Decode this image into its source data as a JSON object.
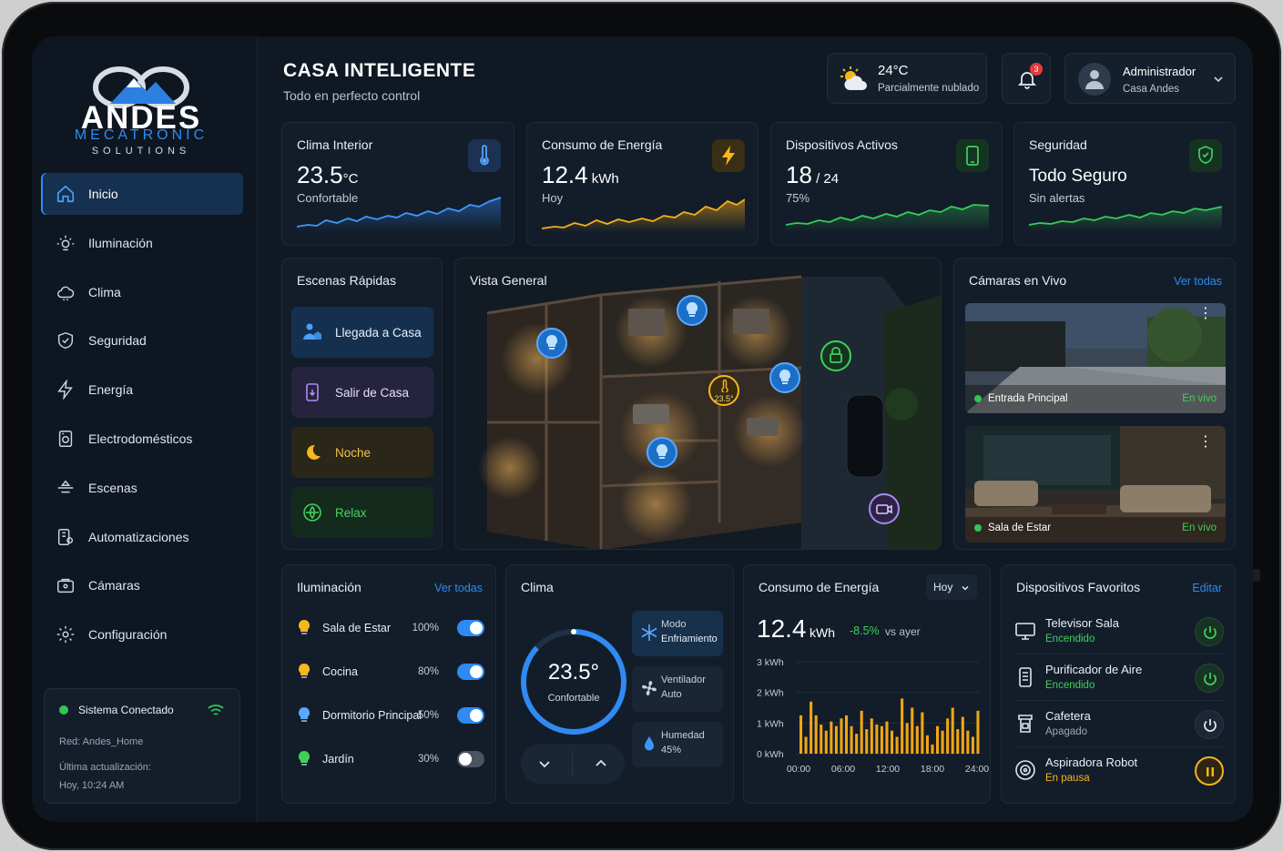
{
  "brand": {
    "name": "ANDES",
    "line2": "MECATRONIC",
    "line3": "SOLUTIONS"
  },
  "nav": {
    "items": [
      {
        "label": "Inicio",
        "icon": "home-icon"
      },
      {
        "label": "Iluminación",
        "icon": "sun-icon"
      },
      {
        "label": "Clima",
        "icon": "cloud-icon"
      },
      {
        "label": "Seguridad",
        "icon": "shield-icon"
      },
      {
        "label": "Energía",
        "icon": "bolt-icon"
      },
      {
        "label": "Electrodomésticos",
        "icon": "appliance-icon"
      },
      {
        "label": "Escenas",
        "icon": "scenes-icon"
      },
      {
        "label": "Automatizaciones",
        "icon": "automation-icon"
      },
      {
        "label": "Cámaras",
        "icon": "camera-icon"
      },
      {
        "label": "Configuración",
        "icon": "gear-icon"
      }
    ]
  },
  "system": {
    "status": "Sistema Conectado",
    "network": "Red: Andes_Home",
    "updated_label": "Última actualización:",
    "updated_value": "Hoy, 10:24 AM"
  },
  "header": {
    "title": "CASA INTELIGENTE",
    "subtitle": "Todo en perfecto control"
  },
  "weather": {
    "temp": "24°C",
    "desc": "Parcialmente nublado"
  },
  "notifications": {
    "count": "3"
  },
  "user": {
    "name": "Administrador",
    "home": "Casa Andes"
  },
  "stats": {
    "climate": {
      "title": "Clima Interior",
      "value": "23.5",
      "unit": "°C",
      "sub": "Confortable"
    },
    "energy": {
      "title": "Consumo de Energía",
      "value": "12.4",
      "unit": " kWh",
      "sub": "Hoy"
    },
    "devices": {
      "title": "Dispositivos Activos",
      "value": "18",
      "unit": " / 24",
      "sub": "75%"
    },
    "security": {
      "title": "Seguridad",
      "value": "Todo Seguro",
      "sub": "Sin alertas"
    }
  },
  "scenes": {
    "title": "Escenas Rápidas",
    "items": [
      "Llegada a Casa",
      "Salir de Casa",
      "Noche",
      "Relax"
    ]
  },
  "overview": {
    "title": "Vista General",
    "temp_marker": "23.5°"
  },
  "cameras": {
    "title": "Cámaras en Vivo",
    "link": "Ver todas",
    "items": [
      {
        "name": "Entrada Principal",
        "status": "En vivo"
      },
      {
        "name": "Sala de Estar",
        "status": "En vivo"
      }
    ]
  },
  "lighting": {
    "title": "Iluminación",
    "link": "Ver todas",
    "items": [
      {
        "name": "Sala de Estar",
        "pct": "100%",
        "on": true,
        "color": "#f5b81d"
      },
      {
        "name": "Cocina",
        "pct": "80%",
        "on": true,
        "color": "#f5b81d"
      },
      {
        "name": "Dormitorio Principal",
        "pct": "50%",
        "on": true,
        "color": "#5aa9ff"
      },
      {
        "name": "Jardín",
        "pct": "30%",
        "on": false,
        "color": "#3fd05a"
      }
    ]
  },
  "climate": {
    "title": "Clima",
    "value": "23.5°",
    "label": "Confortable",
    "modes": [
      {
        "a": "Modo",
        "b": "Enfriamiento"
      },
      {
        "a": "Ventilador",
        "b": "Auto"
      },
      {
        "a": "Humedad",
        "b": "45%"
      }
    ]
  },
  "energy": {
    "title": "Consumo de Energía",
    "period": "Hoy",
    "value": "12.4",
    "unit": "kWh",
    "delta": "-8.5%",
    "delta_suffix": "vs ayer"
  },
  "chart_data": {
    "type": "bar",
    "title": "",
    "ylabel": "",
    "xlabel": "",
    "ylim": [
      0,
      3
    ],
    "yticks": [
      "3 kWh",
      "2 kWh",
      "1 kWh",
      "0 kWh"
    ],
    "xticks": [
      "00:00",
      "06:00",
      "12:00",
      "18:00",
      "24:00"
    ],
    "values": [
      1.25,
      0.55,
      1.7,
      1.25,
      0.95,
      0.75,
      1.05,
      0.9,
      1.15,
      1.25,
      0.9,
      0.65,
      1.4,
      0.8,
      1.15,
      0.95,
      0.9,
      1.05,
      0.75,
      0.55,
      1.8,
      1.0,
      1.5,
      0.9,
      1.35,
      0.6,
      0.3,
      0.9,
      0.75,
      1.15,
      1.5,
      0.8,
      1.2,
      0.75,
      0.55,
      1.4
    ],
    "color": "#f2a613"
  },
  "favorites": {
    "title": "Dispositivos Favoritos",
    "link": "Editar",
    "items": [
      {
        "name": "Televisor Sala",
        "state": "Encendido",
        "color": "#3fd05a"
      },
      {
        "name": "Purificador de Aire",
        "state": "Encendido",
        "color": "#3fd05a"
      },
      {
        "name": "Cafetera",
        "state": "Apagado",
        "color": "#9aa6b4"
      },
      {
        "name": "Aspiradora Robot",
        "state": "En pausa",
        "color": "#f2b51d"
      }
    ]
  }
}
